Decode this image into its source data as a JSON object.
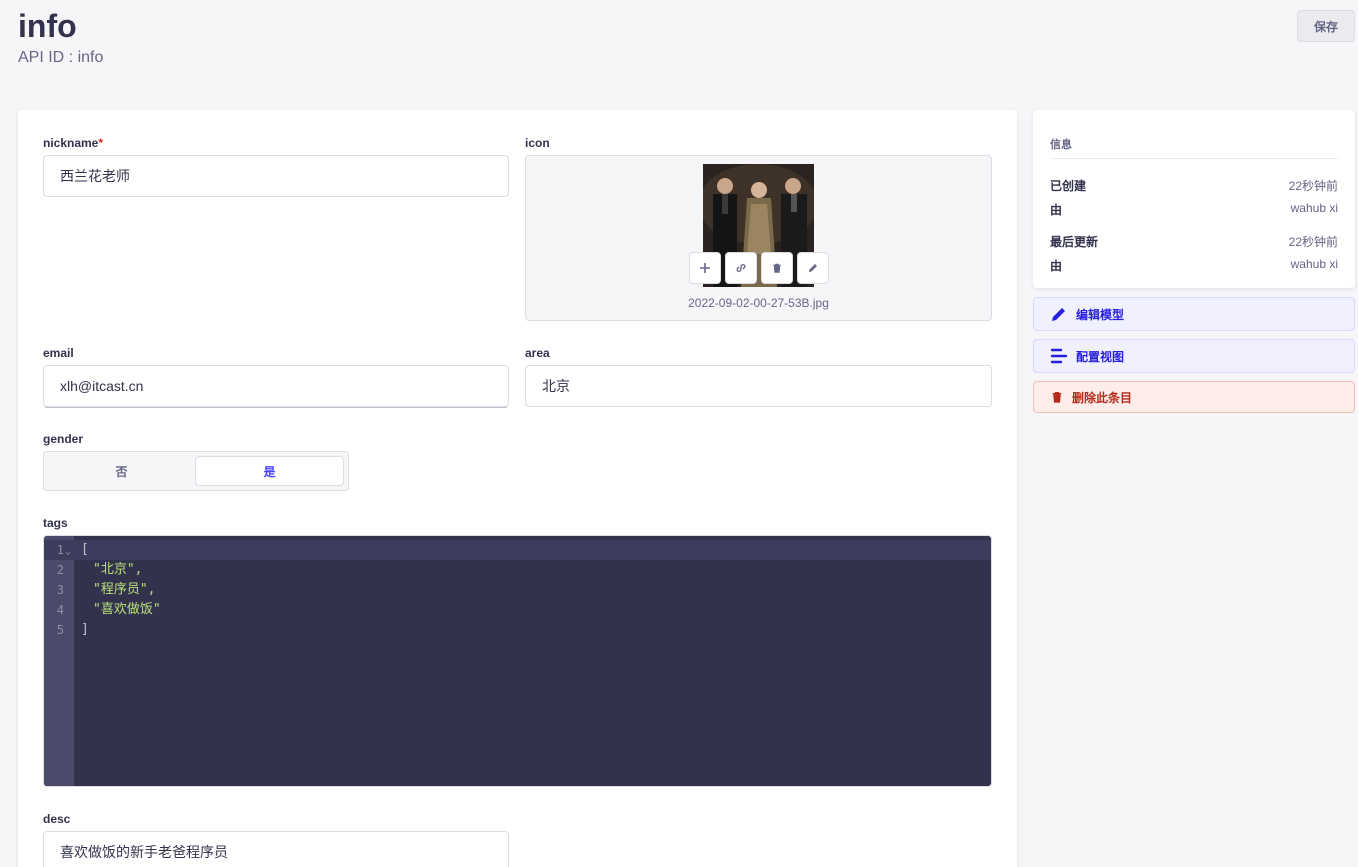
{
  "header": {
    "title": "info",
    "api_id": "API ID : info",
    "save_label": "保存"
  },
  "form": {
    "nickname": {
      "label": "nickname",
      "required_mark": "*",
      "value": "西兰花老师"
    },
    "icon": {
      "label": "icon",
      "file_name": "2022-09-02-00-27-53B.jpg",
      "actions": [
        "plus-icon",
        "link-icon",
        "trash-icon",
        "pencil-icon"
      ]
    },
    "email": {
      "label": "email",
      "value": "xlh@itcast.cn"
    },
    "area": {
      "label": "area",
      "value": "北京"
    },
    "gender": {
      "label": "gender",
      "options": [
        "否",
        "是"
      ],
      "selected": "是"
    },
    "tags": {
      "label": "tags",
      "line_numbers": [
        "1",
        "2",
        "3",
        "4",
        "5"
      ],
      "lines": [
        "[",
        "\"北京\",",
        "\"程序员\",",
        "\"喜欢做饭\"",
        "]"
      ]
    },
    "desc": {
      "label": "desc",
      "value": "喜欢做饭的新手老爸程序员"
    }
  },
  "sidebar": {
    "info_title": "信息",
    "created_label": "已创建",
    "created_value": "22秒钟前",
    "created_by_label": "由",
    "created_by_value": "wahub xi",
    "updated_label": "最后更新",
    "updated_value": "22秒钟前",
    "updated_by_label": "由",
    "updated_by_value": "wahub xi",
    "edit_model_label": "编辑模型",
    "configure_view_label": "配置视图",
    "delete_label": "删除此条目"
  },
  "colors": {
    "primary": "#4945ff",
    "danger": "#d02b20",
    "editor_bg": "#32324d"
  }
}
